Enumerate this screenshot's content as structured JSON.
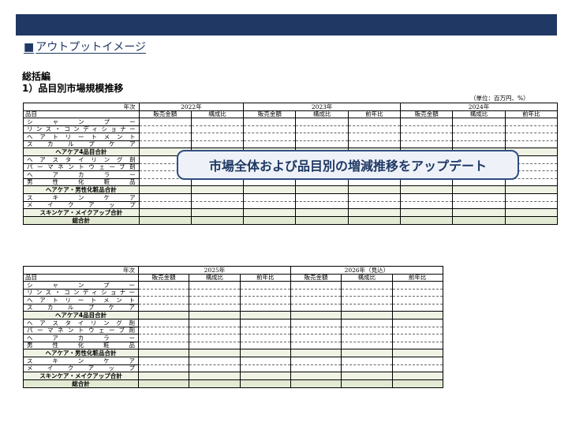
{
  "section_heading": {
    "bullet": "■",
    "text": "アウトプットイメージ"
  },
  "document": {
    "title": "総括編",
    "subtitle": "1）品目別市場規模推移",
    "unit_note": "（単位：百万円、%）"
  },
  "table_header": {
    "nendo": "年次",
    "hinmoku": "品目"
  },
  "rows": [
    {
      "label": "シャンプー",
      "kind": "cat"
    },
    {
      "label": "リンス・コンディショナー",
      "kind": "cat"
    },
    {
      "label": "ヘアトリートメント",
      "kind": "cat"
    },
    {
      "label": "スカルプケア",
      "kind": "cat"
    },
    {
      "label": "ヘアケア4品目合計",
      "kind": "total"
    },
    {
      "label": "ヘアスタイリング剤",
      "kind": "cat"
    },
    {
      "label": "パーマネントウェーブ剤",
      "kind": "cat"
    },
    {
      "label": "ヘアカラー",
      "kind": "cat"
    },
    {
      "label": "男性化粧品",
      "kind": "cat"
    },
    {
      "label": "ヘアケア・男性化粧品合計",
      "kind": "total"
    },
    {
      "label": "スキンケア",
      "kind": "cat"
    },
    {
      "label": "メイクアップ",
      "kind": "cat"
    },
    {
      "label": "スキンケア・メイクアップ合計",
      "kind": "total"
    },
    {
      "label": "総合計",
      "kind": "grand"
    }
  ],
  "table1": {
    "years": [
      {
        "label": "2022年",
        "cols": [
          "販売金額",
          "構成比"
        ]
      },
      {
        "label": "2023年",
        "cols": [
          "販売金額",
          "構成比",
          "前年比"
        ]
      },
      {
        "label": "2024年",
        "cols": [
          "販売金額",
          "構成比",
          "前年比"
        ]
      }
    ]
  },
  "table2": {
    "years": [
      {
        "label": "2025年",
        "cols": [
          "販売金額",
          "構成比",
          "前年比"
        ]
      },
      {
        "label": "2026年（見込）",
        "cols": [
          "販売金額",
          "構成比",
          "前年比"
        ]
      }
    ]
  },
  "overlay_banner": "市場全体および品目別の増減推移をアップデート",
  "colors": {
    "header_bar": "#1f3864",
    "heading_text": "#1f3864",
    "overlay_border": "#2f4d82",
    "overlay_bg": "#eef2f8"
  }
}
